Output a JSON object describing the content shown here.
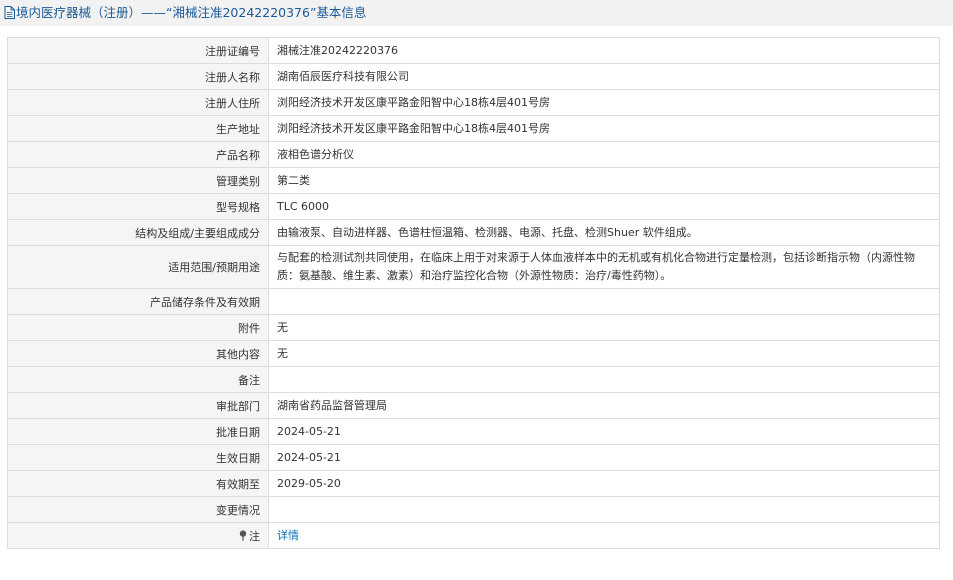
{
  "header": {
    "title": "境内医疗器械（注册）——“湘械注准20242220376”基本信息",
    "icon": "document-icon"
  },
  "rows": [
    {
      "label": "注册证编号",
      "value": "湘械注准20242220376"
    },
    {
      "label": "注册人名称",
      "value": "湖南佰辰医疗科技有限公司"
    },
    {
      "label": "注册人住所",
      "value": "浏阳经济技术开发区康平路金阳智中心18栋4层401号房"
    },
    {
      "label": "生产地址",
      "value": "浏阳经济技术开发区康平路金阳智中心18栋4层401号房"
    },
    {
      "label": "产品名称",
      "value": "液相色谱分析仪"
    },
    {
      "label": "管理类别",
      "value": "第二类"
    },
    {
      "label": "型号规格",
      "value": "TLC 6000"
    },
    {
      "label": "结构及组成/主要组成成分",
      "value": "由输液泵、自动进样器、色谱柱恒温箱、检测器、电源、托盘、检测Shuer 软件组成。"
    },
    {
      "label": "适用范围/预期用途",
      "value": "与配套的检测试剂共同使用，在临床上用于对来源于人体血液样本中的无机或有机化合物进行定量检测，包括诊断指示物（内源性物质：氨基酸、维生素、激素）和治疗监控化合物（外源性物质：治疗/毒性药物）。"
    },
    {
      "label": "产品储存条件及有效期",
      "value": ""
    },
    {
      "label": "附件",
      "value": "无"
    },
    {
      "label": "其他内容",
      "value": "无"
    },
    {
      "label": "备注",
      "value": ""
    },
    {
      "label": "审批部门",
      "value": "湖南省药品监督管理局"
    },
    {
      "label": "批准日期",
      "value": "2024-05-21"
    },
    {
      "label": "生效日期",
      "value": "2024-05-21"
    },
    {
      "label": "有效期至",
      "value": "2029-05-20"
    },
    {
      "label": "变更情况",
      "value": ""
    }
  ],
  "footer": {
    "label": "注",
    "link": "详情",
    "icon": "pin-icon"
  },
  "colors": {
    "title_text": "#1a5a96",
    "link": "#1a6fb5",
    "label_bg": "#f5f5f5",
    "border": "#dcdcdc"
  }
}
